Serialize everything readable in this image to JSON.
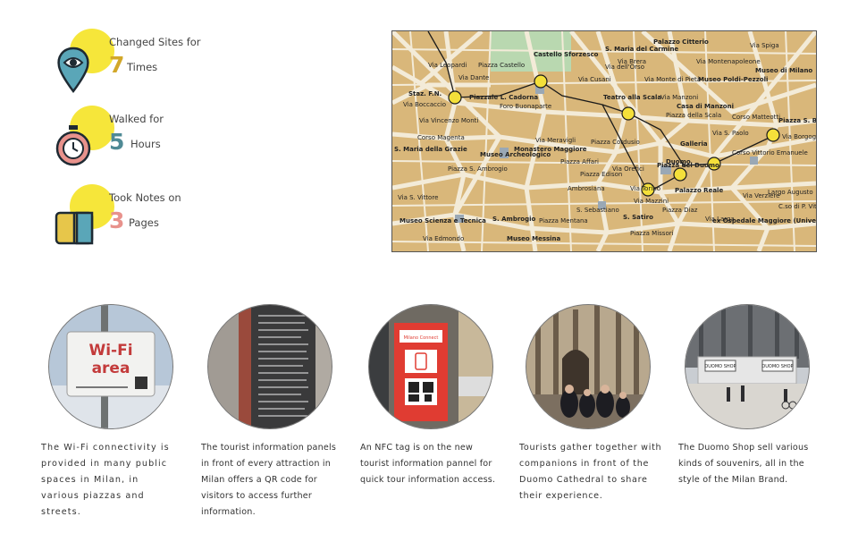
{
  "stats": [
    {
      "label": "Changed Sites for",
      "value": "7",
      "unit": "Times",
      "color": "#d2a82a",
      "icon": "location-pin-eye-icon"
    },
    {
      "label": "Walked for",
      "value": "5",
      "unit": "Hours",
      "color": "#4f8a95",
      "icon": "stopwatch-icon"
    },
    {
      "label": "Took Notes on",
      "value": "3",
      "unit": "Pages",
      "color": "#e8928c",
      "icon": "notebook-icon"
    }
  ],
  "map": {
    "labels": [
      "Via Leopardi",
      "Staz. F.N.",
      "Piazzale L. Cadorna",
      "Via Boccaccio",
      "Via Vincenzo Monti",
      "S. Maria della Grazie",
      "Corso Magenta",
      "Museo Archeologico",
      "Monastero Maggiore",
      "S. Ambrogio",
      "Piazza S. Ambrogio",
      "Via S. Vittore",
      "Museo Scienza e Tecnica",
      "Via Edmondo",
      "Castello Sforzesco",
      "Piazza Castello",
      "Foro Buonaparte",
      "Via Cusani",
      "S. Maria del Carmine",
      "Palazzo Citterio",
      "Via dell'Orso",
      "Teatro alla Scala",
      "Piazza Cordusio",
      "Via Meravigli",
      "Piazza Affari",
      "Piazza Edison",
      "Ambrosiana",
      "Via Torino",
      "Museo Messina",
      "S. Satiro",
      "S. Sebastiano",
      "Piazza Mentana",
      "Piazza Missori",
      "Piazza del Duomo",
      "Duomo",
      "Galleria",
      "Piazza della Scala",
      "Casa di Manzoni",
      "Museo Poldi-Pezzoli",
      "Museo di Milano",
      "Corso Matteotti",
      "Piazza S. Babila",
      "Via Borgogna",
      "Palazzo Reale",
      "Piazza Diaz",
      "Largo Augusto",
      "Via Larga",
      "ex Ospedale Maggiore (University)",
      "Corso Vittorio Emanuele",
      "Via Verziere",
      "C.so di P. Vittoria",
      "Via S. Paolo",
      "Via Monte di Pietà",
      "Via Manzoni",
      "Via Montenapoleone",
      "Via Dante",
      "Via Brera",
      "Via Orefici",
      "Via Mazzini",
      "Via Spiga"
    ]
  },
  "photos": [
    {
      "caption": "The Wi-Fi connectivity is provided in many public spaces in Milan, in various piazzas and streets.",
      "sign_line1": "Wi-Fi",
      "sign_line2": "area"
    },
    {
      "caption": "The tourist information panels in front of every attraction in Milan offers a QR code for visitors to access further information."
    },
    {
      "caption": "An NFC tag is on the new tourist information pannel for quick tour information access.",
      "panel_title": "Milano Connect"
    },
    {
      "caption": "Tourists gather together with companions in front of the Duomo Cathedral to share their experience."
    },
    {
      "caption": "The Duomo Shop sell various kinds of souvenirs, all in the style of the Milan Brand.",
      "shop_sign": "DUOMO SHOP"
    }
  ]
}
